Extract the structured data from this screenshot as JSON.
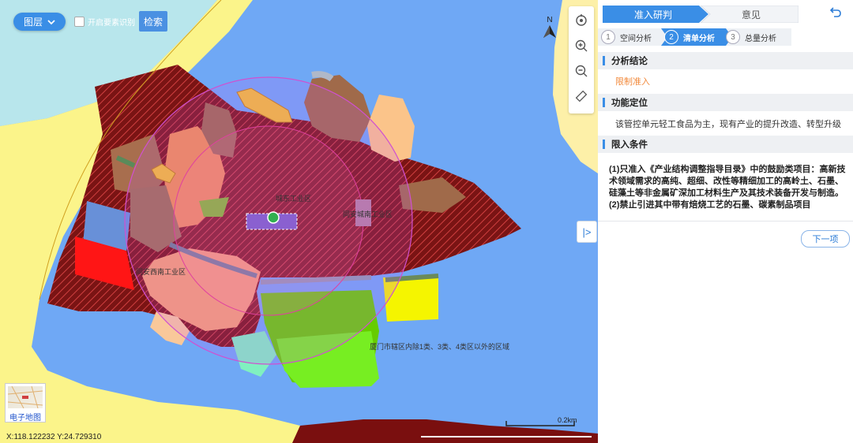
{
  "toolbar": {
    "layer_label": "图层",
    "feature_toggle_label": "开启要素识别",
    "search_label": "检索"
  },
  "map": {
    "north_label": "N",
    "labels": {
      "chengdong": "城东工业区",
      "tongan": "同安城南工业区",
      "west": "同安西南工业区",
      "xiamen": "厦门市辖区内除1类、3类、4类区以外的区域"
    },
    "scale_label": "0.2km",
    "coordinates": "X:118.122232 Y:24.729310",
    "basemap_label": "电子地图",
    "tools": [
      "refresh-icon",
      "zoom-in-icon",
      "zoom-out-icon",
      "ruler-icon"
    ]
  },
  "panel": {
    "tabs": [
      {
        "label": "准入研判",
        "active": true
      },
      {
        "label": "意见",
        "active": false
      }
    ],
    "steps": [
      {
        "num": "1",
        "label": "空间分析",
        "active": false
      },
      {
        "num": "2",
        "label": "清单分析",
        "active": true
      },
      {
        "num": "3",
        "label": "总量分析",
        "active": false
      }
    ],
    "sections": {
      "conclusion_title": "分析结论",
      "conclusion_value": "限制准入",
      "function_title": "功能定位",
      "function_value": "该管控单元轻工食品为主，现有产业的提升改造、转型升级",
      "limits_title": "限入条件",
      "limits_1": "(1)只准入《产业结构调整指导目录》中的鼓励类项目：高新技术领域需求的高纯、超细、改性等精细加工的高岭土、石墨、硅藻土等非金属矿深加工材料生产及其技术装备开发与制造。",
      "limits_2": "(2)禁止引进其中带有焙烧工艺的石墨、碳素制品项目"
    },
    "next_label": "下一项"
  },
  "colors": {
    "accent": "#3a8ee6",
    "restricted": "#f28a3c",
    "water": "#6fa8f5",
    "industrial": "#8b1a1a"
  }
}
